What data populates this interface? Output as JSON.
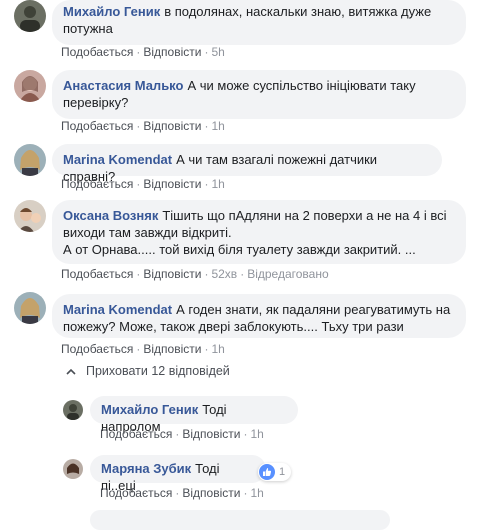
{
  "comments": [
    {
      "author": "Михайло Геник",
      "text": "в подолянах, наскальки знаю, витяжка дуже потужна",
      "like": "Подобається",
      "reply": "Відповісти",
      "time": "5h"
    },
    {
      "author": "Анастасия Малько",
      "text": "А чи може суспільство ініціювати таку перевірку?",
      "like": "Подобається",
      "reply": "Відповісти",
      "time": "1h"
    },
    {
      "author": "Marina Komendat",
      "text": "А чи там взагалі пожежні датчики справні?",
      "like": "Подобається",
      "reply": "Відповісти",
      "time": "1h"
    },
    {
      "author": "Оксана Возняк",
      "text": "Тішить що пАдляни на 2 поверхи а не на 4 і всі виходи там завжди відкриті.",
      "text2": "А от Орнава..... той вихід біля туалету завжди закритий. ...",
      "like": "Подобається",
      "reply": "Відповісти",
      "time": "52хв",
      "edited": "Відредаговано"
    },
    {
      "author": "Marina Komendat",
      "text": "А годен знати, як падаляни реагуватимуть на пожежу? Може, також двері заблокують.... Тьху три рази",
      "like": "Подобається",
      "reply": "Відповісти",
      "time": "1h"
    }
  ],
  "hide_replies": "Приховати 12 відповідей",
  "replies": [
    {
      "author": "Михайло Геник",
      "text": "Тоді напролом",
      "like": "Подобається",
      "reply": "Відповісти",
      "time": "1h"
    },
    {
      "author": "Маряна Зубик",
      "text": "Тоді пі..еці",
      "like": "Подобається",
      "reply": "Відповісти",
      "time": "1h",
      "reaction_count": "1"
    }
  ],
  "colors": {
    "author": "#385898",
    "bubble": "#f2f3f5",
    "meta": "#90949c",
    "link": "#4b4f56",
    "like_blue": "#5890ff"
  }
}
